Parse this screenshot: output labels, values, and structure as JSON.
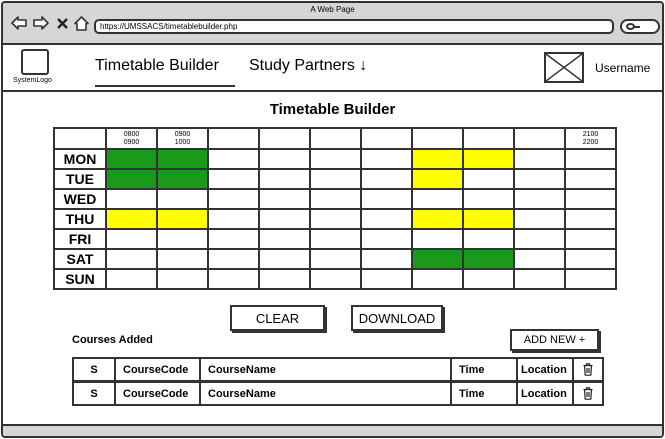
{
  "window": {
    "title": "A Web Page",
    "url": "https://UMSSACS/timetablebuilder.php"
  },
  "icons": {
    "back": "arrow-left-icon",
    "forward": "arrow-right-icon",
    "close": "close-icon",
    "home": "home-icon",
    "search": "search-icon",
    "avatar": "image-placeholder-icon",
    "delete": "trash-icon"
  },
  "header": {
    "logo_label": "SystemLogo",
    "tabs": [
      {
        "label": "Timetable Builder"
      },
      {
        "label": "Study Partners ↓"
      }
    ],
    "username": "Username"
  },
  "page": {
    "title": "Timetable Builder"
  },
  "timetable": {
    "columns": [
      [
        "0800",
        "0900"
      ],
      [
        "0900",
        "1000"
      ],
      [
        "",
        ""
      ],
      [
        "",
        ""
      ],
      [
        "",
        ""
      ],
      [
        "",
        ""
      ],
      [
        "",
        ""
      ],
      [
        "",
        ""
      ],
      [
        "",
        ""
      ],
      [
        "2100",
        "2200"
      ]
    ],
    "days": [
      "MON",
      "TUE",
      "WED",
      "THU",
      "FRI",
      "SAT",
      "SUN"
    ],
    "colors": {
      "green": "#1a9a1a",
      "yellow": "#ffff00"
    },
    "cells": [
      [
        "green",
        "green",
        "",
        "",
        "",
        "",
        "yellow",
        "yellow",
        "",
        ""
      ],
      [
        "green",
        "green",
        "",
        "",
        "",
        "",
        "yellow",
        "",
        "",
        ""
      ],
      [
        "",
        "",
        "",
        "",
        "",
        "",
        "",
        "",
        "",
        ""
      ],
      [
        "yellow",
        "yellow",
        "",
        "",
        "",
        "",
        "yellow",
        "yellow",
        "",
        ""
      ],
      [
        "",
        "",
        "",
        "",
        "",
        "",
        "",
        "",
        "",
        ""
      ],
      [
        "",
        "",
        "",
        "",
        "",
        "",
        "green",
        "green",
        "",
        ""
      ],
      [
        "",
        "",
        "",
        "",
        "",
        "",
        "",
        "",
        "",
        ""
      ]
    ]
  },
  "actions": {
    "clear": "CLEAR",
    "download": "DOWNLOAD",
    "add_new": "ADD NEW +"
  },
  "courses": {
    "label": "Courses Added",
    "rows": [
      {
        "s": "S",
        "code": "CourseCode",
        "name": "CourseName",
        "time": "Time",
        "location": "Location"
      },
      {
        "s": "S",
        "code": "CourseCode",
        "name": "CourseName",
        "time": "Time",
        "location": "Location"
      }
    ]
  }
}
